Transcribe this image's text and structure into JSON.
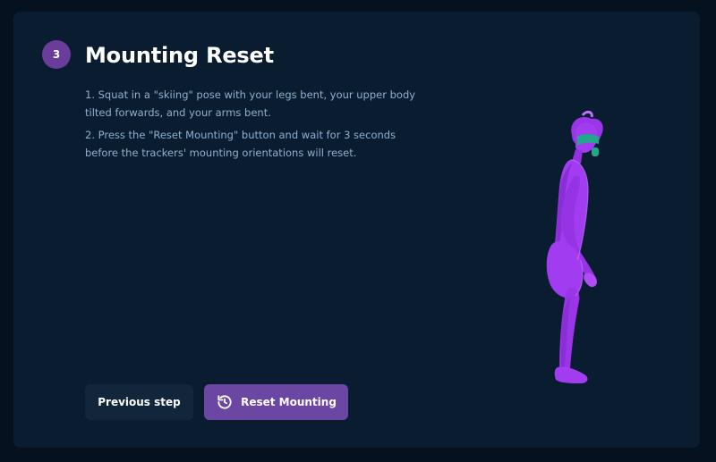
{
  "step": {
    "number": "3",
    "title": "Mounting Reset"
  },
  "instructions": [
    "1. Squat in a \"skiing\" pose with your legs bent, your upper body tilted forwards, and your arms bent.",
    "2. Press the \"Reset Mounting\" button and wait for 3 seconds before the trackers' mounting orientations will reset."
  ],
  "buttons": {
    "previous": "Previous step",
    "reset": "Reset Mounting",
    "reset_icon": "reset-arrow-icon"
  },
  "colors": {
    "background": "#061120",
    "card": "#0a1c30",
    "accent": "#6b46a3",
    "badge": "#6b3d9a",
    "figure": "#a13cf0"
  },
  "illustration": "skiing-pose-figure"
}
